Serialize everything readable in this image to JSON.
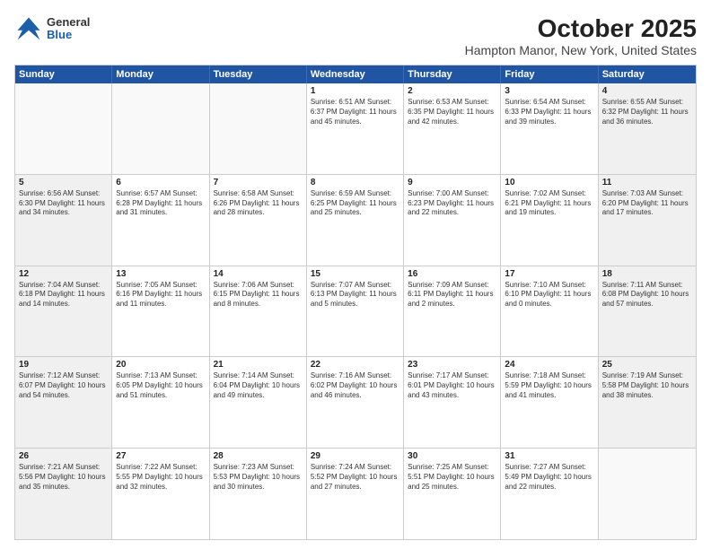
{
  "header": {
    "logo": {
      "general": "General",
      "blue": "Blue"
    },
    "month": "October 2025",
    "location": "Hampton Manor, New York, United States"
  },
  "weekdays": [
    "Sunday",
    "Monday",
    "Tuesday",
    "Wednesday",
    "Thursday",
    "Friday",
    "Saturday"
  ],
  "weeks": [
    [
      {
        "day": "",
        "info": "",
        "empty": true
      },
      {
        "day": "",
        "info": "",
        "empty": true
      },
      {
        "day": "",
        "info": "",
        "empty": true
      },
      {
        "day": "1",
        "info": "Sunrise: 6:51 AM\nSunset: 6:37 PM\nDaylight: 11 hours\nand 45 minutes.",
        "empty": false
      },
      {
        "day": "2",
        "info": "Sunrise: 6:53 AM\nSunset: 6:35 PM\nDaylight: 11 hours\nand 42 minutes.",
        "empty": false
      },
      {
        "day": "3",
        "info": "Sunrise: 6:54 AM\nSunset: 6:33 PM\nDaylight: 11 hours\nand 39 minutes.",
        "empty": false
      },
      {
        "day": "4",
        "info": "Sunrise: 6:55 AM\nSunset: 6:32 PM\nDaylight: 11 hours\nand 36 minutes.",
        "empty": false
      }
    ],
    [
      {
        "day": "5",
        "info": "Sunrise: 6:56 AM\nSunset: 6:30 PM\nDaylight: 11 hours\nand 34 minutes.",
        "empty": false
      },
      {
        "day": "6",
        "info": "Sunrise: 6:57 AM\nSunset: 6:28 PM\nDaylight: 11 hours\nand 31 minutes.",
        "empty": false
      },
      {
        "day": "7",
        "info": "Sunrise: 6:58 AM\nSunset: 6:26 PM\nDaylight: 11 hours\nand 28 minutes.",
        "empty": false
      },
      {
        "day": "8",
        "info": "Sunrise: 6:59 AM\nSunset: 6:25 PM\nDaylight: 11 hours\nand 25 minutes.",
        "empty": false
      },
      {
        "day": "9",
        "info": "Sunrise: 7:00 AM\nSunset: 6:23 PM\nDaylight: 11 hours\nand 22 minutes.",
        "empty": false
      },
      {
        "day": "10",
        "info": "Sunrise: 7:02 AM\nSunset: 6:21 PM\nDaylight: 11 hours\nand 19 minutes.",
        "empty": false
      },
      {
        "day": "11",
        "info": "Sunrise: 7:03 AM\nSunset: 6:20 PM\nDaylight: 11 hours\nand 17 minutes.",
        "empty": false
      }
    ],
    [
      {
        "day": "12",
        "info": "Sunrise: 7:04 AM\nSunset: 6:18 PM\nDaylight: 11 hours\nand 14 minutes.",
        "empty": false
      },
      {
        "day": "13",
        "info": "Sunrise: 7:05 AM\nSunset: 6:16 PM\nDaylight: 11 hours\nand 11 minutes.",
        "empty": false
      },
      {
        "day": "14",
        "info": "Sunrise: 7:06 AM\nSunset: 6:15 PM\nDaylight: 11 hours\nand 8 minutes.",
        "empty": false
      },
      {
        "day": "15",
        "info": "Sunrise: 7:07 AM\nSunset: 6:13 PM\nDaylight: 11 hours\nand 5 minutes.",
        "empty": false
      },
      {
        "day": "16",
        "info": "Sunrise: 7:09 AM\nSunset: 6:11 PM\nDaylight: 11 hours\nand 2 minutes.",
        "empty": false
      },
      {
        "day": "17",
        "info": "Sunrise: 7:10 AM\nSunset: 6:10 PM\nDaylight: 11 hours\nand 0 minutes.",
        "empty": false
      },
      {
        "day": "18",
        "info": "Sunrise: 7:11 AM\nSunset: 6:08 PM\nDaylight: 10 hours\nand 57 minutes.",
        "empty": false
      }
    ],
    [
      {
        "day": "19",
        "info": "Sunrise: 7:12 AM\nSunset: 6:07 PM\nDaylight: 10 hours\nand 54 minutes.",
        "empty": false
      },
      {
        "day": "20",
        "info": "Sunrise: 7:13 AM\nSunset: 6:05 PM\nDaylight: 10 hours\nand 51 minutes.",
        "empty": false
      },
      {
        "day": "21",
        "info": "Sunrise: 7:14 AM\nSunset: 6:04 PM\nDaylight: 10 hours\nand 49 minutes.",
        "empty": false
      },
      {
        "day": "22",
        "info": "Sunrise: 7:16 AM\nSunset: 6:02 PM\nDaylight: 10 hours\nand 46 minutes.",
        "empty": false
      },
      {
        "day": "23",
        "info": "Sunrise: 7:17 AM\nSunset: 6:01 PM\nDaylight: 10 hours\nand 43 minutes.",
        "empty": false
      },
      {
        "day": "24",
        "info": "Sunrise: 7:18 AM\nSunset: 5:59 PM\nDaylight: 10 hours\nand 41 minutes.",
        "empty": false
      },
      {
        "day": "25",
        "info": "Sunrise: 7:19 AM\nSunset: 5:58 PM\nDaylight: 10 hours\nand 38 minutes.",
        "empty": false
      }
    ],
    [
      {
        "day": "26",
        "info": "Sunrise: 7:21 AM\nSunset: 5:56 PM\nDaylight: 10 hours\nand 35 minutes.",
        "empty": false
      },
      {
        "day": "27",
        "info": "Sunrise: 7:22 AM\nSunset: 5:55 PM\nDaylight: 10 hours\nand 32 minutes.",
        "empty": false
      },
      {
        "day": "28",
        "info": "Sunrise: 7:23 AM\nSunset: 5:53 PM\nDaylight: 10 hours\nand 30 minutes.",
        "empty": false
      },
      {
        "day": "29",
        "info": "Sunrise: 7:24 AM\nSunset: 5:52 PM\nDaylight: 10 hours\nand 27 minutes.",
        "empty": false
      },
      {
        "day": "30",
        "info": "Sunrise: 7:25 AM\nSunset: 5:51 PM\nDaylight: 10 hours\nand 25 minutes.",
        "empty": false
      },
      {
        "day": "31",
        "info": "Sunrise: 7:27 AM\nSunset: 5:49 PM\nDaylight: 10 hours\nand 22 minutes.",
        "empty": false
      },
      {
        "day": "",
        "info": "",
        "empty": true
      }
    ]
  ]
}
